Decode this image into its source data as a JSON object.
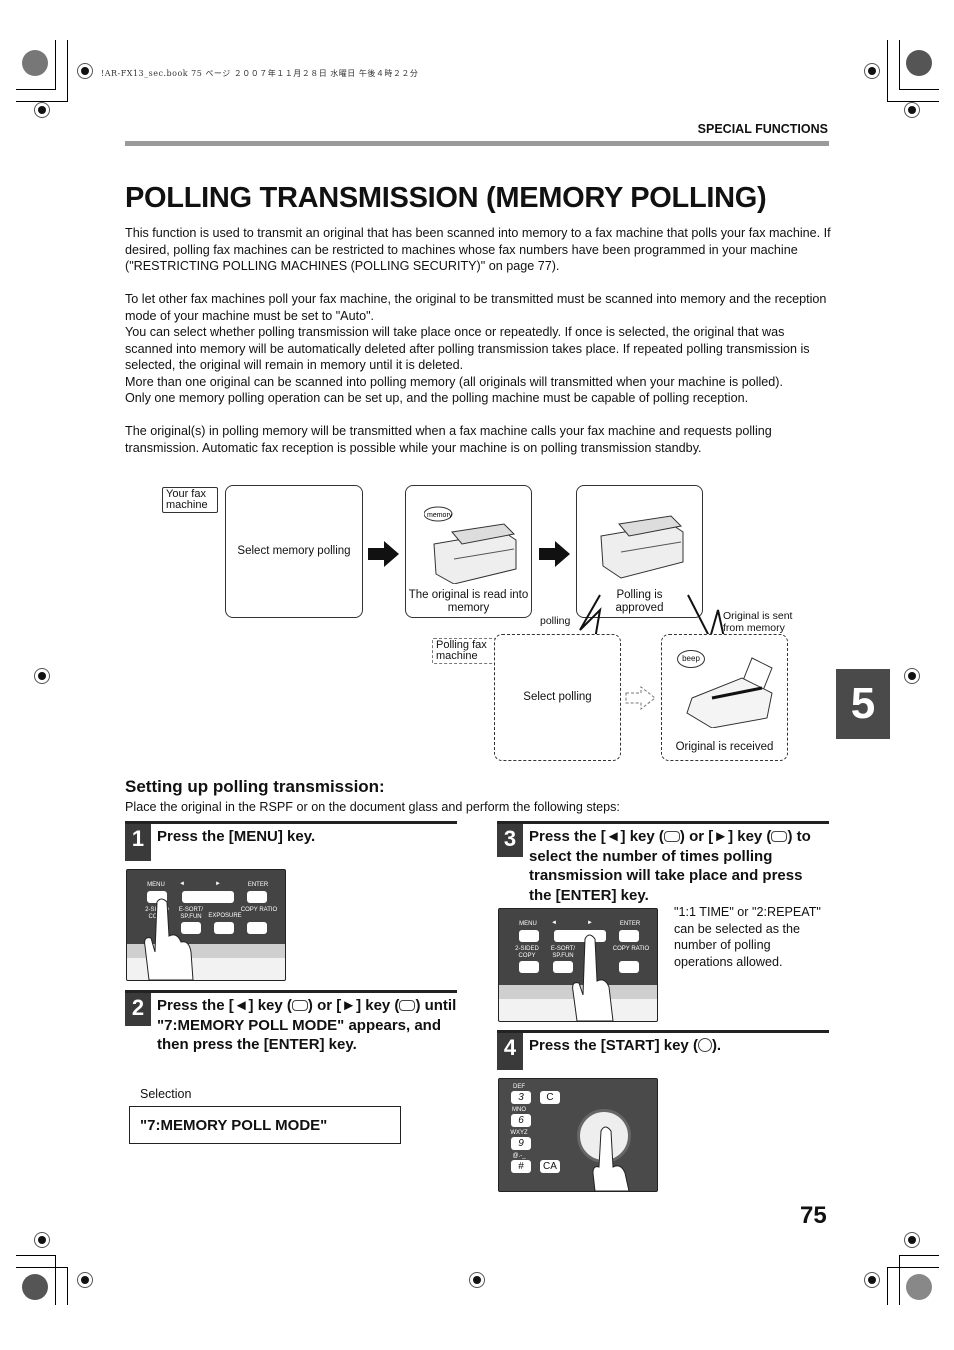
{
  "printer_meta": "!AR-FX13_sec.book  75 ページ  ２００７年１１月２８日  水曜日  午後４時２２分",
  "header": {
    "section": "SPECIAL FUNCTIONS"
  },
  "title": "POLLING TRANSMISSION (MEMORY POLLING)",
  "paragraphs": [
    "This function is used to transmit an original that has been scanned into memory to a fax machine that polls your fax machine. If desired, polling fax machines can be restricted to machines whose fax numbers have been programmed in your machine (\"RESTRICTING POLLING MACHINES (POLLING SECURITY)\" on page 77).",
    "To let other fax machines poll your fax machine, the original to be transmitted must be scanned into memory and the reception mode of your machine must be set to \"Auto\".",
    "You can select whether polling transmission will take place once or repeatedly. If once is selected, the original that was scanned into memory will be automatically deleted after polling transmission takes place. If repeated polling transmission is selected, the original will remain in memory until it is deleted.",
    "More than one original can be scanned into polling memory (all originals will transmitted when your machine is polled).",
    "Only one memory polling operation can be set up, and the polling machine must be capable of polling reception.",
    "The original(s) in polling memory will be transmitted when a fax machine calls your fax machine and requests polling transmission. Automatic fax reception is possible while your machine is on polling transmission standby."
  ],
  "diagram": {
    "your_fax_tag": "Your fax machine",
    "polling_fax_tag": "Polling fax machine",
    "step_select_memory": "Select memory polling",
    "step_read_memory": "The original is read into memory",
    "memory_bubble": "memory",
    "step_approved": "Polling is approved",
    "polling_label": "polling",
    "sent_label": "Original is sent from memory",
    "select_polling": "Select polling",
    "beep": "beep",
    "received": "Original is received"
  },
  "setup": {
    "heading": "Setting up polling transmission:",
    "intro": "Place the original in the RSPF or on the document glass and perform the following steps:",
    "steps": [
      {
        "num": "1",
        "text": "Press the [MENU] key."
      },
      {
        "num": "2",
        "parts": [
          "Press the [◄] key (",
          ") or [►] key (",
          ") until \"7:MEMORY POLL MODE\" appears, and then press the [ENTER] key."
        ]
      },
      {
        "num": "3",
        "parts": [
          "Press the [◄] key (",
          ") or [►] key (",
          ") to select the number of times polling transmission will take place and press the [ENTER] key."
        ]
      },
      {
        "num": "4",
        "parts": [
          "Press the  [START] key (",
          ")."
        ]
      }
    ],
    "selection_label": "Selection",
    "selection_value": "\"7:MEMORY POLL MODE\"",
    "note": "\"1:1 TIME\" or \"2:REPEAT\" can be selected as the number of polling operations allowed."
  },
  "panel": {
    "menu": "MENU",
    "left": "◄",
    "right": "►",
    "enter": "ENTER",
    "two_sided": "2-SIDED COPY",
    "esort": "E-SORT/ SP.FUN",
    "exposure": "EXPOSURE",
    "copy_ratio": "COPY RATIO",
    "keys": [
      "3",
      "6",
      "9",
      "#"
    ],
    "key_letters": [
      "DEF",
      "MNO",
      "WXYZ",
      "@.-_"
    ],
    "c": "C",
    "ca": "CA"
  },
  "chapter_tab": "5",
  "page_number": "75"
}
